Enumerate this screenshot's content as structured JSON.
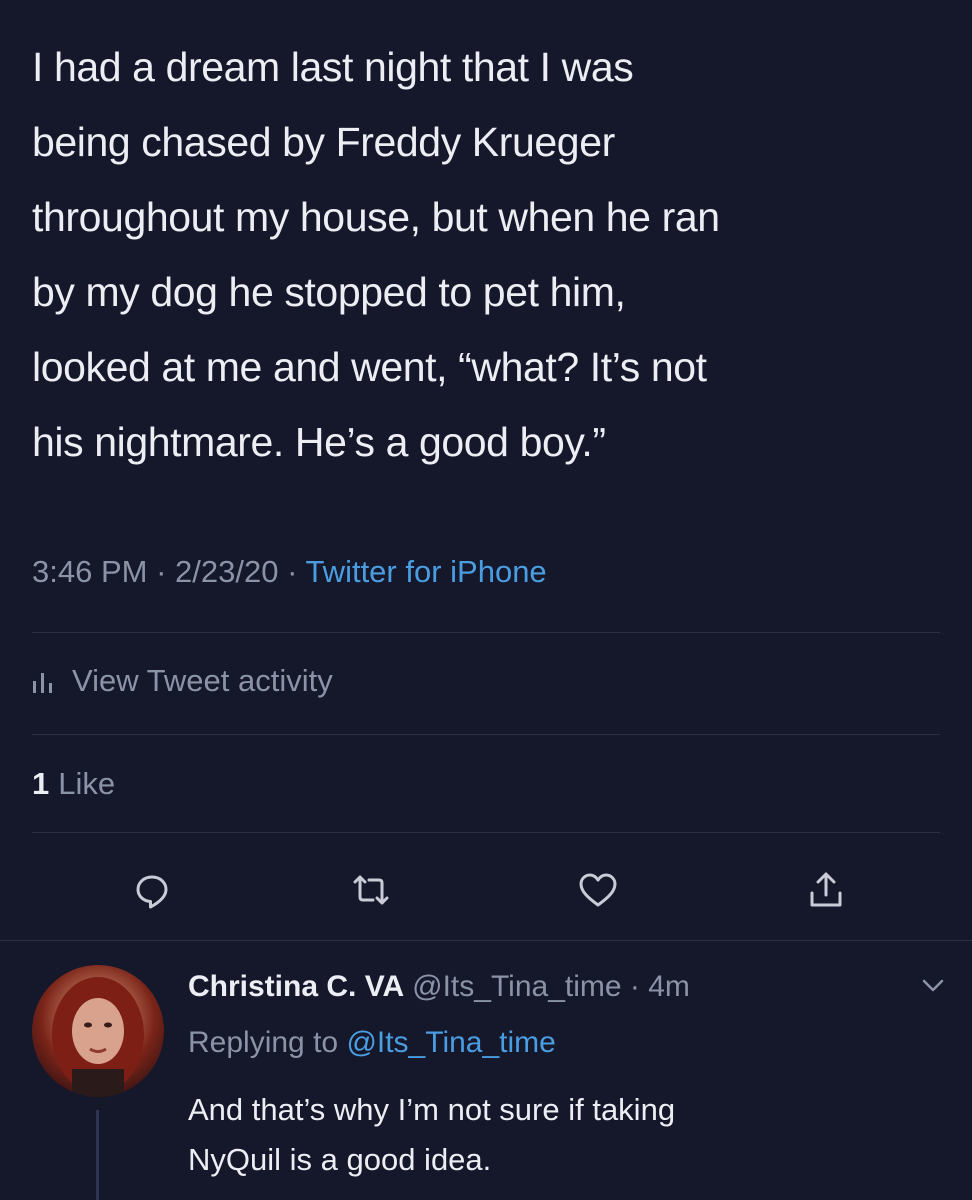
{
  "tweet": {
    "text_lines": [
      "I had a dream last night that I was",
      "being chased by Freddy Krueger",
      "throughout my house, but when he ran",
      "by my dog he stopped to pet him,",
      "looked at me and went, “what? It’s not",
      "his nightmare. He’s a good boy.”"
    ],
    "time": "3:46 PM",
    "separator": " · ",
    "date": "2/23/20",
    "source": "Twitter for iPhone",
    "activity_label": "View Tweet activity",
    "likes_count": "1",
    "likes_label": "Like"
  },
  "actions": {
    "icons": [
      "reply-icon",
      "retweet-icon",
      "like-icon",
      "share-icon"
    ]
  },
  "reply": {
    "display_name": "Christina C. VA",
    "handle": "@Its_Tina_time",
    "separator": " · ",
    "time_ago": "4m",
    "replying_prefix": "Replying to ",
    "replying_to": "@Its_Tina_time",
    "text_lines": [
      "And that’s why I’m not sure if taking",
      "NyQuil is a good idea."
    ]
  },
  "colors": {
    "background": "#15172b",
    "text": "#eceef3",
    "muted": "#8b93a7",
    "link": "#4a9de0"
  }
}
